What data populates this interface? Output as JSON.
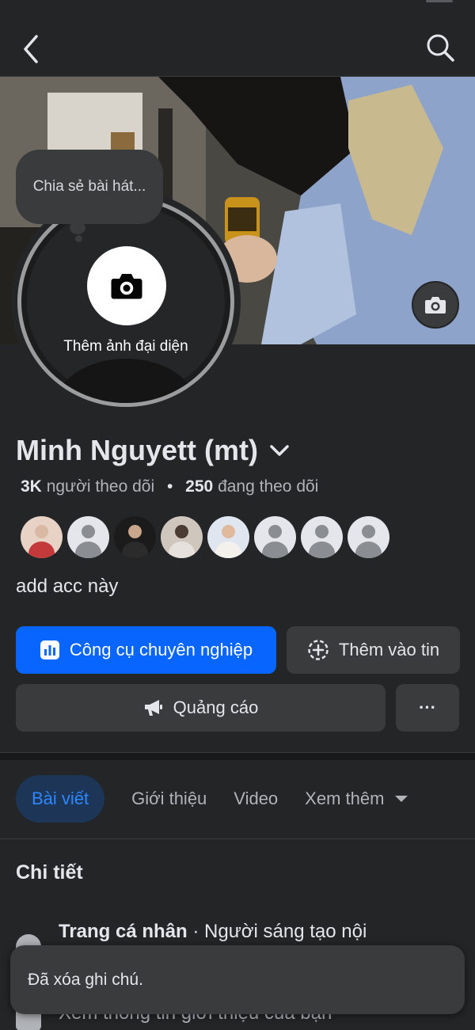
{
  "header": {
    "back_icon": "chevron-left-icon",
    "search_icon": "search-icon"
  },
  "cover": {
    "camera_icon": "camera-icon"
  },
  "avatar": {
    "add_label": "Thêm ảnh đại diện",
    "camera_icon": "camera-icon"
  },
  "note_bubble": {
    "text": "Chia sẻ bài hát..."
  },
  "profile": {
    "name": "Minh Nguyett (mt)",
    "followers_count": "3K",
    "followers_label": "người theo dõi",
    "separator": "•",
    "following_count": "250",
    "following_label": "đang theo dõi",
    "bio": "add acc này"
  },
  "friends_preview": {
    "avatars": [
      "photo",
      "default",
      "photo",
      "photo",
      "photo",
      "default",
      "default",
      "default"
    ]
  },
  "actions": {
    "pro_tools_label": "Công cụ chuyên nghiệp",
    "add_story_label": "Thêm vào tin",
    "ads_label": "Quảng cáo",
    "more_label": "···"
  },
  "tabs": [
    {
      "label": "Bài viết",
      "active": true
    },
    {
      "label": "Giới thiệu",
      "active": false
    },
    {
      "label": "Video",
      "active": false
    },
    {
      "label": "Xem thêm",
      "active": false
    }
  ],
  "details": {
    "title": "Chi tiết",
    "page_type_bold": "Trang cá nhân",
    "page_type_rest": " · Người sáng tạo nội",
    "see_intro": "Xem thông tin giới thiệu của bạn"
  },
  "toast": {
    "text": "Đã xóa ghi chú."
  },
  "colors": {
    "background": "#242526",
    "primary_button": "#0866ff",
    "active_tab_text": "#2d88ff",
    "secondary_button": "#3a3b3c"
  }
}
